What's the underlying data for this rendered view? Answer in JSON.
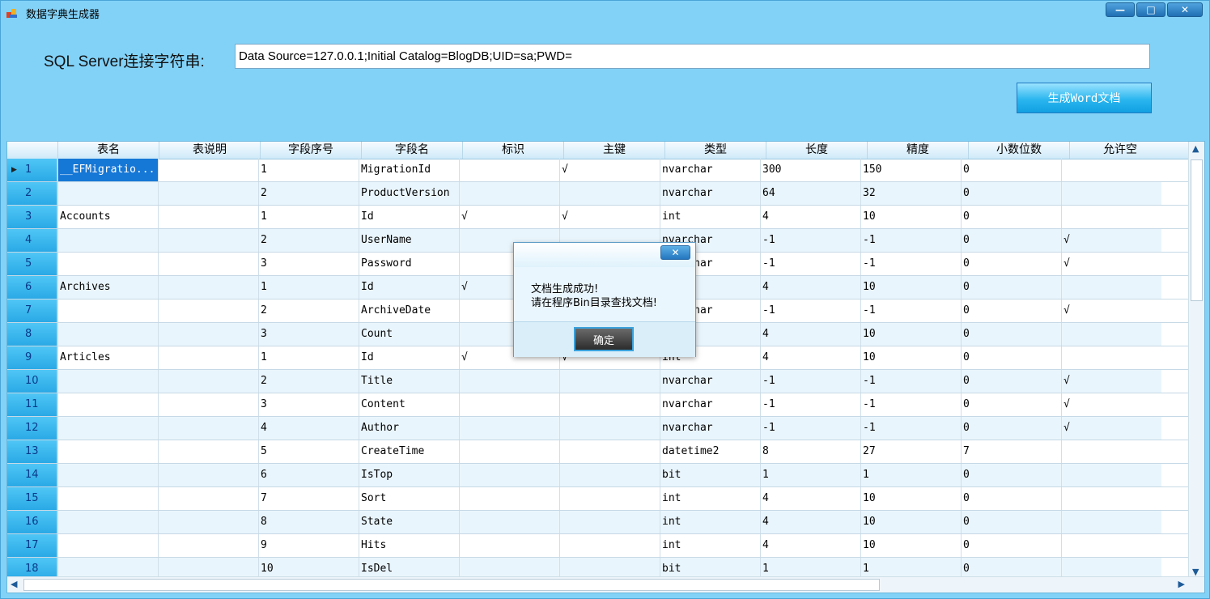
{
  "window": {
    "title": "数据字典生成器",
    "controls": {
      "minimize": "—",
      "maximize": "□",
      "close": "✕"
    }
  },
  "connection": {
    "label": "SQL Server连接字符串:",
    "value": "Data Source=127.0.0.1;Initial Catalog=BlogDB;UID=sa;PWD="
  },
  "generate_button": "生成Word文档",
  "grid": {
    "columns": [
      "表名",
      "表说明",
      "字段序号",
      "字段名",
      "标识",
      "主键",
      "类型",
      "长度",
      "精度",
      "小数位数",
      "允许空"
    ],
    "rows": [
      {
        "no": "1",
        "cells": [
          "__EFMigratio...",
          "",
          "1",
          "MigrationId",
          "",
          "√",
          "nvarchar",
          "300",
          "150",
          "0",
          ""
        ]
      },
      {
        "no": "2",
        "cells": [
          "",
          "",
          "2",
          "ProductVersion",
          "",
          "",
          "nvarchar",
          "64",
          "32",
          "0",
          ""
        ]
      },
      {
        "no": "3",
        "cells": [
          "Accounts",
          "",
          "1",
          "Id",
          "√",
          "√",
          "int",
          "4",
          "10",
          "0",
          ""
        ]
      },
      {
        "no": "4",
        "cells": [
          "",
          "",
          "2",
          "UserName",
          "",
          "",
          "nvarchar",
          "-1",
          "-1",
          "0",
          "√"
        ]
      },
      {
        "no": "5",
        "cells": [
          "",
          "",
          "3",
          "Password",
          "",
          "",
          "nvarchar",
          "-1",
          "-1",
          "0",
          "√"
        ]
      },
      {
        "no": "6",
        "cells": [
          "Archives",
          "",
          "1",
          "Id",
          "√",
          "",
          "",
          "4",
          "10",
          "0",
          ""
        ]
      },
      {
        "no": "7",
        "cells": [
          "",
          "",
          "2",
          "ArchiveDate",
          "",
          "",
          "nvarchar",
          "-1",
          "-1",
          "0",
          "√"
        ]
      },
      {
        "no": "8",
        "cells": [
          "",
          "",
          "3",
          "Count",
          "",
          "",
          "",
          "4",
          "10",
          "0",
          ""
        ]
      },
      {
        "no": "9",
        "cells": [
          "Articles",
          "",
          "1",
          "Id",
          "√",
          "√",
          "int",
          "4",
          "10",
          "0",
          ""
        ]
      },
      {
        "no": "10",
        "cells": [
          "",
          "",
          "2",
          "Title",
          "",
          "",
          "nvarchar",
          "-1",
          "-1",
          "0",
          "√"
        ]
      },
      {
        "no": "11",
        "cells": [
          "",
          "",
          "3",
          "Content",
          "",
          "",
          "nvarchar",
          "-1",
          "-1",
          "0",
          "√"
        ]
      },
      {
        "no": "12",
        "cells": [
          "",
          "",
          "4",
          "Author",
          "",
          "",
          "nvarchar",
          "-1",
          "-1",
          "0",
          "√"
        ]
      },
      {
        "no": "13",
        "cells": [
          "",
          "",
          "5",
          "CreateTime",
          "",
          "",
          "datetime2",
          "8",
          "27",
          "7",
          ""
        ]
      },
      {
        "no": "14",
        "cells": [
          "",
          "",
          "6",
          "IsTop",
          "",
          "",
          "bit",
          "1",
          "1",
          "0",
          ""
        ]
      },
      {
        "no": "15",
        "cells": [
          "",
          "",
          "7",
          "Sort",
          "",
          "",
          "int",
          "4",
          "10",
          "0",
          ""
        ]
      },
      {
        "no": "16",
        "cells": [
          "",
          "",
          "8",
          "State",
          "",
          "",
          "int",
          "4",
          "10",
          "0",
          ""
        ]
      },
      {
        "no": "17",
        "cells": [
          "",
          "",
          "9",
          "Hits",
          "",
          "",
          "int",
          "4",
          "10",
          "0",
          ""
        ]
      },
      {
        "no": "18",
        "cells": [
          "",
          "",
          "10",
          "IsDel",
          "",
          "",
          "bit",
          "1",
          "1",
          "0",
          ""
        ]
      }
    ]
  },
  "dialog": {
    "close": "✕",
    "line1": "文档生成成功!",
    "line2": "请在程序Bin目录查找文档!",
    "ok": "确定"
  },
  "scrollbar": {
    "up": "▲",
    "down": "▼",
    "left": "◀",
    "right": "▶"
  },
  "current_row_marker": "▶"
}
